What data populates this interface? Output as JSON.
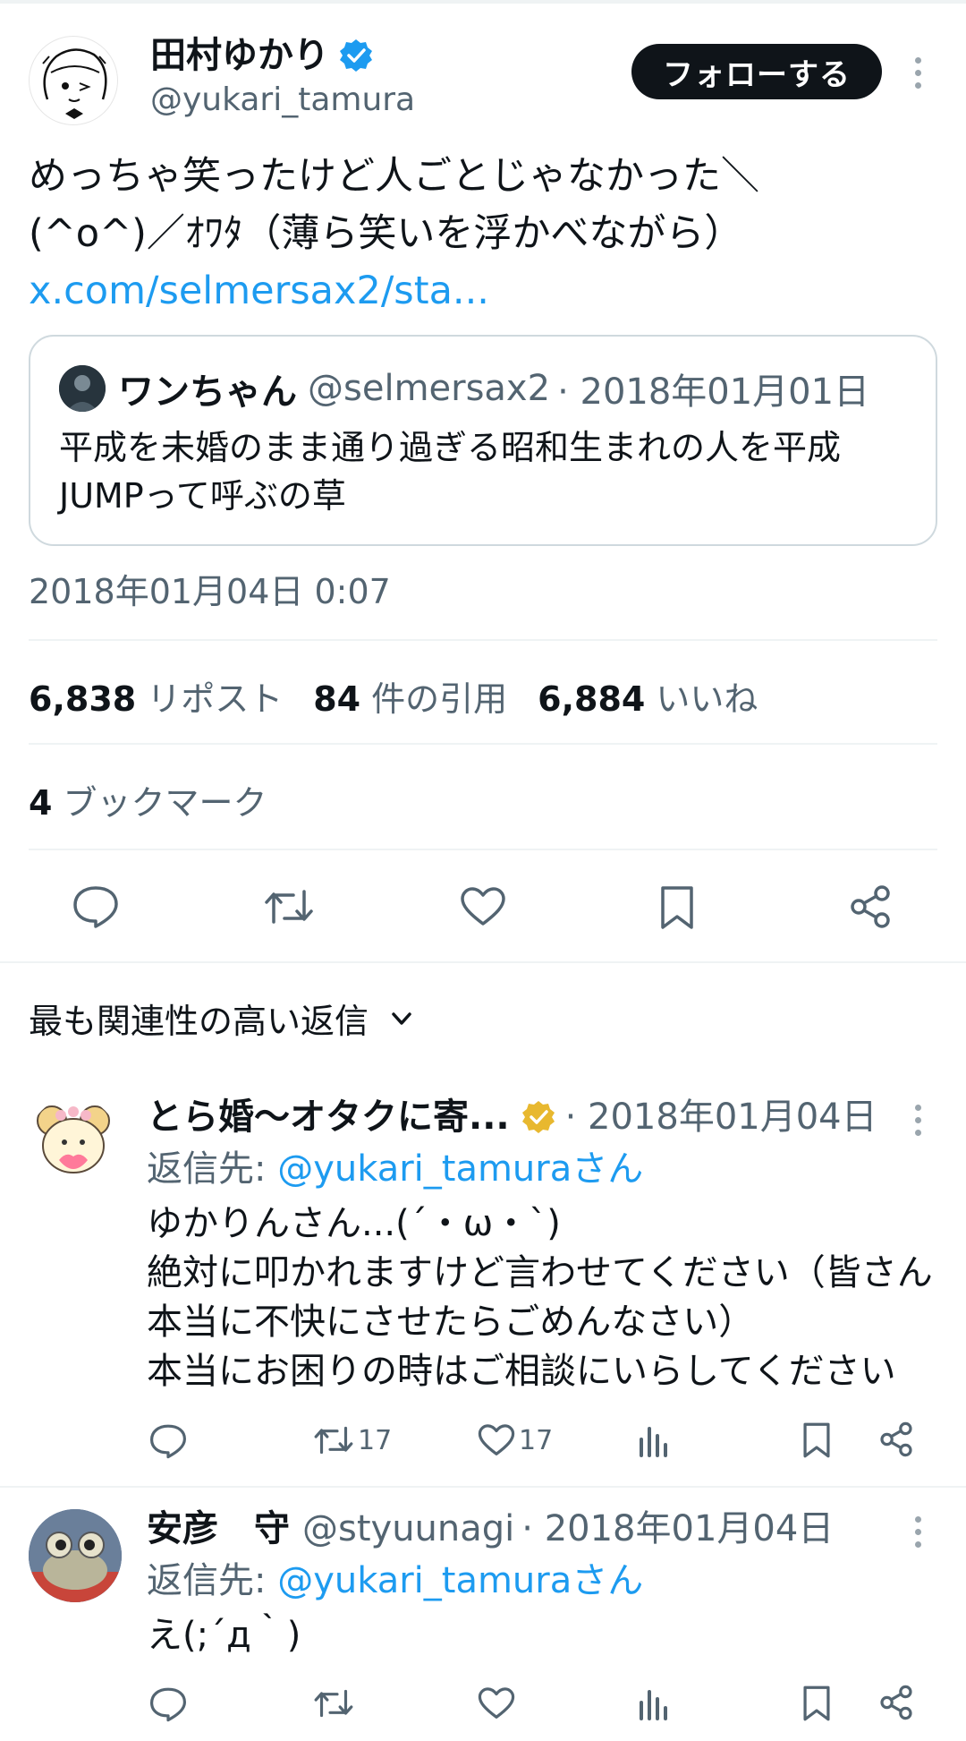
{
  "tweet": {
    "author_name": "田村ゆかり",
    "author_handle": "@yukari_tamura",
    "follow_label": "フォローする",
    "text_lines": [
      "めっちゃ笑ったけど人ごとじゃなかった＼",
      "(^o^)／ｵﾜﾀ（薄ら笑いを浮かべながら）"
    ],
    "link": "x.com/selmersax2/sta...",
    "timestamp": "2018年01月04日 0:07",
    "reposts_count": "6,838",
    "reposts_label": "リポスト",
    "quotes_count": "84",
    "quotes_label": "件の引用",
    "likes_count": "6,884",
    "likes_label": "いいね",
    "bookmarks_count": "4",
    "bookmarks_label": "ブックマーク"
  },
  "quoted_tweet": {
    "author_name": "ワンちゃん",
    "author_handle": "@selmersax2",
    "date": "· 2018年01月01日",
    "text_lines": [
      "平成を未婚のまま通り過ぎる昭和生まれの人を平成",
      "JUMPって呼ぶの草"
    ]
  },
  "replies_sort_label": "最も関連性の高い返信",
  "replies": [
    {
      "author_name": "とら婚〜オタクに寄...",
      "date": "· 2018年01月04日",
      "reply_to_prefix": "返信先: ",
      "reply_to_handle": "@yukari_tamuraさん",
      "text_lines": [
        "ゆかりんさん...(´・ω・`)",
        "絶対に叩かれますけど言わせてください（皆さん",
        "本当に不快にさせたらごめんなさい）",
        "本当にお困りの時はご相談にいらしてください"
      ],
      "retweets": "17",
      "likes": "17",
      "verified_color": "#e8b82f"
    },
    {
      "author_name": "安彦　守",
      "author_handle": "@styuunagi",
      "date": "· 2018年01月04日",
      "reply_to_prefix": "返信先: ",
      "reply_to_handle": "@yukari_tamuraさん",
      "text_lines": [
        "え(;´д｀)"
      ]
    }
  ],
  "colors": {
    "verified_blue": "#1d9bf0",
    "link_blue": "#1d9bf0",
    "text_dark": "#0f1419",
    "text_muted": "#536471"
  }
}
